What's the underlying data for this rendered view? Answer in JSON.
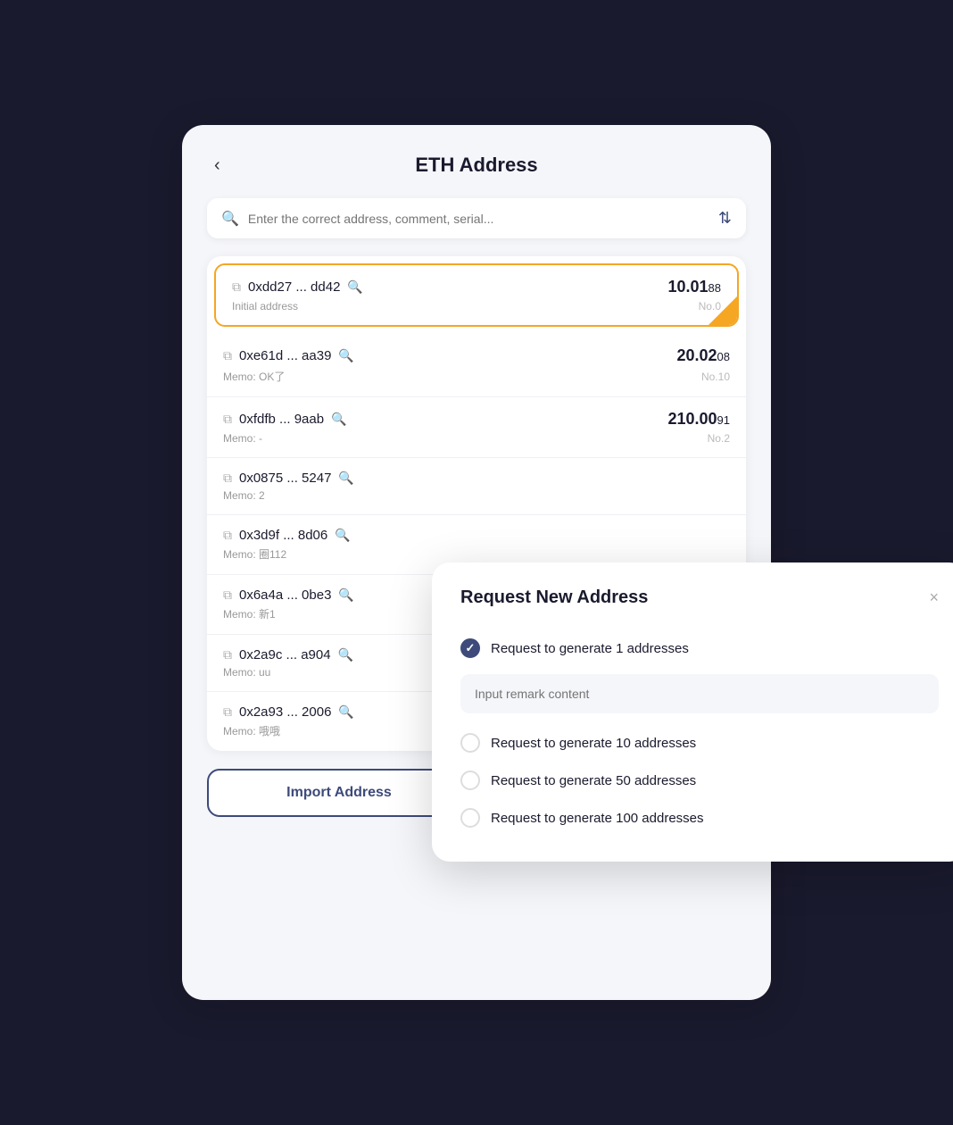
{
  "header": {
    "title": "ETH Address",
    "back_label": "‹"
  },
  "search": {
    "placeholder": "Enter the correct address, comment, serial..."
  },
  "addresses": [
    {
      "id": 0,
      "text": "0xdd27 ... dd42",
      "amount_main": "10.01",
      "amount_decimal": "88",
      "label": "Initial address",
      "num": "No.0",
      "active": true
    },
    {
      "id": 1,
      "text": "0xe61d ... aa39",
      "amount_main": "20.02",
      "amount_decimal": "08",
      "label": "Memo: OK了",
      "num": "No.10",
      "active": false
    },
    {
      "id": 2,
      "text": "0xfdfb ... 9aab",
      "amount_main": "210.00",
      "amount_decimal": "91",
      "label": "Memo: -",
      "num": "No.2",
      "active": false
    },
    {
      "id": 3,
      "text": "0x0875 ... 5247",
      "amount_main": "",
      "amount_decimal": "",
      "label": "Memo: 2",
      "num": "",
      "active": false
    },
    {
      "id": 4,
      "text": "0x3d9f ... 8d06",
      "amount_main": "",
      "amount_decimal": "",
      "label": "Memo: 圈112",
      "num": "",
      "active": false
    },
    {
      "id": 5,
      "text": "0x6a4a ... 0be3",
      "amount_main": "",
      "amount_decimal": "",
      "label": "Memo: 新1",
      "num": "",
      "active": false
    },
    {
      "id": 6,
      "text": "0x2a9c ... a904",
      "amount_main": "",
      "amount_decimal": "",
      "label": "Memo: uu",
      "num": "",
      "active": false
    },
    {
      "id": 7,
      "text": "0x2a93 ... 2006",
      "amount_main": "",
      "amount_decimal": "",
      "label": "Memo: 哦哦",
      "num": "",
      "active": false
    }
  ],
  "buttons": {
    "import": "Import Address",
    "request": "Request New Address"
  },
  "modal": {
    "title": "Request New Address",
    "close_label": "×",
    "remark_placeholder": "Input remark content",
    "options": [
      {
        "id": 0,
        "label": "Request to generate 1 addresses",
        "checked": true
      },
      {
        "id": 1,
        "label": "Request to generate 10 addresses",
        "checked": false
      },
      {
        "id": 2,
        "label": "Request to generate 50 addresses",
        "checked": false
      },
      {
        "id": 3,
        "label": "Request to generate 100 addresses",
        "checked": false
      }
    ]
  }
}
